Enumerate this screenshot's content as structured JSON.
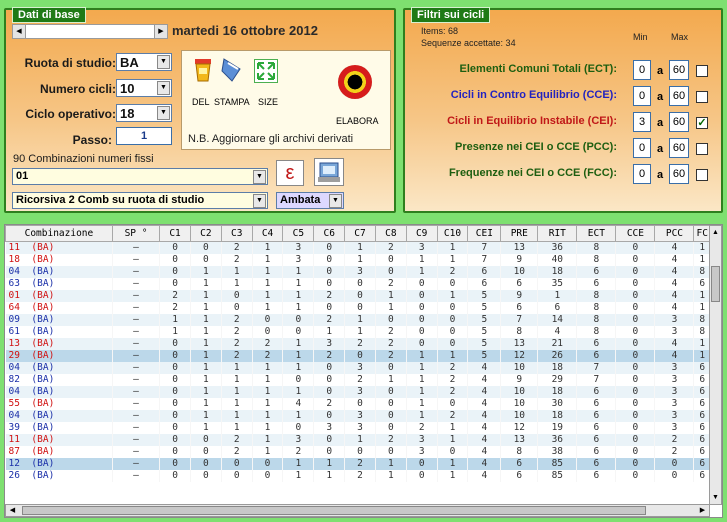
{
  "base": {
    "legend": "Dati di base",
    "date": "martedi 16 ottobre 2012",
    "ruota_label": "Ruota di studio:",
    "ruota_value": "BA",
    "numcicli_label": "Numero cicli:",
    "numcicli_value": "10",
    "ciclo_label": "Ciclo operativo:",
    "ciclo_value": "18",
    "passo_label": "Passo:",
    "passo_value": "1",
    "combinazioni_label": "90 Combinazioni numeri fissi",
    "combo_value": "01",
    "ricorsiva_value": "Ricorsiva 2 Comb su ruota di studio",
    "ambata_value": "Ambata",
    "del_label": "DEL",
    "stampa_label": "STAMPA",
    "size_label": "SIZE",
    "elabora_label": "ELABORA",
    "nb_text": "N.B. Aggiornare gli archivi derivati",
    "epsilon_glyph": "ε"
  },
  "filters": {
    "legend": "Filtri sui cicli",
    "items_text": "Items: 68",
    "sequenze_text": "Sequenze accettate: 34",
    "min_label": "Min",
    "max_label": "Max",
    "a_label": "a",
    "rows": [
      {
        "label": "Elementi Comuni Totali (ECT):",
        "min": "0",
        "max": "60",
        "checked": false,
        "color": "#1d5e10"
      },
      {
        "label": "Cicli in Contro Equilibrio (CCE):",
        "min": "0",
        "max": "60",
        "checked": false,
        "color": "#2222c0"
      },
      {
        "label": "Cicli in Equilibrio Instabile (CEI):",
        "min": "3",
        "max": "60",
        "checked": true,
        "color": "#c01818"
      },
      {
        "label": "Presenze nei CEI o CCE (PCC):",
        "min": "0",
        "max": "60",
        "checked": false,
        "color": "#1d5e10"
      },
      {
        "label": "Frequenze nei CEI o CCE (FCC):",
        "min": "0",
        "max": "60",
        "checked": false,
        "color": "#1d5e10"
      }
    ]
  },
  "table": {
    "columns": [
      "Combinazione",
      "SP °",
      "C1",
      "C2",
      "C3",
      "C4",
      "C5",
      "C6",
      "C7",
      "C8",
      "C9",
      "C10",
      "CEI",
      "PRE",
      "RIT",
      "ECT",
      "CCE",
      "PCC",
      "FC"
    ],
    "rows": [
      {
        "n": "11",
        "r": "(BA)",
        "red": true,
        "v": [
          "–",
          "0",
          "0",
          "2",
          "1",
          "3",
          "0",
          "1",
          "2",
          "3",
          "1",
          "7",
          "13",
          "36",
          "8",
          "0",
          "4",
          "1"
        ]
      },
      {
        "n": "18",
        "r": "(BA)",
        "red": true,
        "v": [
          "–",
          "0",
          "0",
          "2",
          "1",
          "3",
          "0",
          "1",
          "0",
          "1",
          "1",
          "7",
          "9",
          "40",
          "8",
          "0",
          "4",
          "1"
        ]
      },
      {
        "n": "04",
        "r": "(BA)",
        "red": false,
        "v": [
          "–",
          "0",
          "1",
          "1",
          "1",
          "1",
          "0",
          "3",
          "0",
          "1",
          "2",
          "6",
          "10",
          "18",
          "6",
          "0",
          "4",
          "8"
        ]
      },
      {
        "n": "63",
        "r": "(BA)",
        "red": false,
        "v": [
          "–",
          "0",
          "1",
          "1",
          "1",
          "1",
          "0",
          "0",
          "2",
          "0",
          "0",
          "6",
          "6",
          "35",
          "6",
          "0",
          "4",
          "6"
        ]
      },
      {
        "n": "01",
        "r": "(BA)",
        "red": true,
        "v": [
          "–",
          "2",
          "1",
          "0",
          "1",
          "1",
          "2",
          "0",
          "1",
          "0",
          "1",
          "5",
          "9",
          "1",
          "8",
          "0",
          "4",
          "1"
        ]
      },
      {
        "n": "64",
        "r": "(BA)",
        "red": true,
        "v": [
          "–",
          "2",
          "1",
          "0",
          "1",
          "1",
          "0",
          "0",
          "1",
          "0",
          "0",
          "5",
          "6",
          "6",
          "8",
          "0",
          "4",
          "1"
        ]
      },
      {
        "n": "09",
        "r": "(BA)",
        "red": false,
        "v": [
          "–",
          "1",
          "1",
          "2",
          "0",
          "0",
          "2",
          "1",
          "0",
          "0",
          "0",
          "5",
          "7",
          "14",
          "8",
          "0",
          "3",
          "8"
        ]
      },
      {
        "n": "61",
        "r": "(BA)",
        "red": false,
        "v": [
          "–",
          "1",
          "1",
          "2",
          "0",
          "0",
          "1",
          "1",
          "2",
          "0",
          "0",
          "5",
          "8",
          "4",
          "8",
          "0",
          "3",
          "8"
        ]
      },
      {
        "n": "13",
        "r": "(BA)",
        "red": true,
        "v": [
          "–",
          "0",
          "1",
          "2",
          "2",
          "1",
          "3",
          "2",
          "2",
          "0",
          "0",
          "5",
          "13",
          "21",
          "6",
          "0",
          "4",
          "1"
        ]
      },
      {
        "n": "29",
        "r": "(BA)",
        "red": true,
        "hl": true,
        "v": [
          "–",
          "0",
          "1",
          "2",
          "2",
          "1",
          "2",
          "0",
          "2",
          "1",
          "1",
          "5",
          "12",
          "26",
          "6",
          "0",
          "4",
          "1"
        ]
      },
      {
        "n": "04",
        "r": "(BA)",
        "red": false,
        "v": [
          "–",
          "0",
          "1",
          "1",
          "1",
          "1",
          "0",
          "3",
          "0",
          "1",
          "2",
          "4",
          "10",
          "18",
          "7",
          "0",
          "3",
          "6"
        ]
      },
      {
        "n": "82",
        "r": "(BA)",
        "red": false,
        "v": [
          "–",
          "0",
          "1",
          "1",
          "1",
          "0",
          "0",
          "2",
          "1",
          "1",
          "2",
          "4",
          "9",
          "29",
          "7",
          "0",
          "3",
          "6"
        ]
      },
      {
        "n": "04",
        "r": "(BA)",
        "red": false,
        "v": [
          "–",
          "0",
          "1",
          "1",
          "1",
          "1",
          "0",
          "3",
          "0",
          "1",
          "2",
          "4",
          "10",
          "18",
          "6",
          "0",
          "3",
          "6"
        ]
      },
      {
        "n": "55",
        "r": "(BA)",
        "red": true,
        "v": [
          "–",
          "0",
          "1",
          "1",
          "1",
          "4",
          "2",
          "0",
          "0",
          "1",
          "0",
          "4",
          "10",
          "30",
          "6",
          "0",
          "3",
          "6"
        ]
      },
      {
        "n": "04",
        "r": "(BA)",
        "red": false,
        "v": [
          "–",
          "0",
          "1",
          "1",
          "1",
          "1",
          "0",
          "3",
          "0",
          "1",
          "2",
          "4",
          "10",
          "18",
          "6",
          "0",
          "3",
          "6"
        ]
      },
      {
        "n": "39",
        "r": "(BA)",
        "red": false,
        "v": [
          "–",
          "0",
          "1",
          "1",
          "1",
          "0",
          "3",
          "3",
          "0",
          "2",
          "1",
          "4",
          "12",
          "19",
          "6",
          "0",
          "3",
          "6"
        ]
      },
      {
        "n": "11",
        "r": "(BA)",
        "red": true,
        "v": [
          "–",
          "0",
          "0",
          "2",
          "1",
          "3",
          "0",
          "1",
          "2",
          "3",
          "1",
          "4",
          "13",
          "36",
          "6",
          "0",
          "2",
          "6"
        ]
      },
      {
        "n": "87",
        "r": "(BA)",
        "red": true,
        "v": [
          "–",
          "0",
          "0",
          "2",
          "1",
          "2",
          "0",
          "0",
          "0",
          "3",
          "0",
          "4",
          "8",
          "38",
          "6",
          "0",
          "2",
          "6"
        ]
      },
      {
        "n": "12",
        "r": "(BA)",
        "red": false,
        "hl": true,
        "v": [
          "–",
          "0",
          "0",
          "0",
          "0",
          "1",
          "1",
          "2",
          "1",
          "0",
          "1",
          "4",
          "6",
          "85",
          "6",
          "0",
          "0",
          "6"
        ]
      },
      {
        "n": "26",
        "r": "(BA)",
        "red": false,
        "v": [
          "–",
          "0",
          "0",
          "0",
          "0",
          "1",
          "1",
          "2",
          "1",
          "0",
          "1",
          "4",
          "6",
          "85",
          "6",
          "0",
          "0",
          "6"
        ]
      }
    ]
  }
}
